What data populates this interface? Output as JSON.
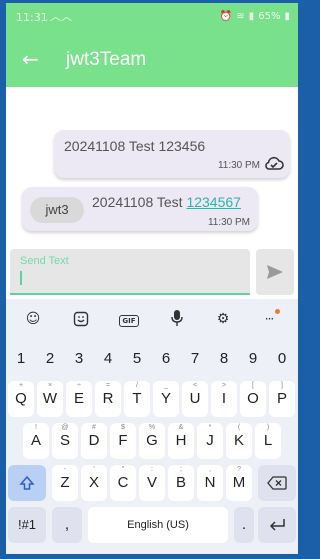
{
  "status_bar": {
    "time": "11:31",
    "wave_glyph": "^^",
    "battery": "65%",
    "icons": [
      "alarm-icon",
      "wifi-icon",
      "signal-icon",
      "battery-icon"
    ]
  },
  "app_bar": {
    "title": "jwt3Team",
    "back_glyph": "←"
  },
  "messages": {
    "outgoing": {
      "text": "20241108 Test 123456",
      "time": "11:30 PM",
      "status_icon": "cloud-check-icon"
    },
    "incoming": {
      "sender": "jwt3",
      "text_plain": "20241108 Test ",
      "text_link": "1234567",
      "time": "11:30 PM"
    }
  },
  "composer": {
    "placeholder": "Send Text",
    "send_icon": "send-icon"
  },
  "keyboard": {
    "toolbar": [
      "emoji-icon",
      "sticker-icon",
      "gif-icon",
      "mic-icon",
      "settings-icon",
      "more-icon"
    ],
    "gif_label": "GIF",
    "numbers": [
      "1",
      "2",
      "3",
      "4",
      "5",
      "6",
      "7",
      "8",
      "9",
      "0"
    ],
    "row1": [
      "Q",
      "W",
      "E",
      "R",
      "T",
      "Y",
      "U",
      "I",
      "O",
      "P"
    ],
    "row1_hints": [
      "+",
      "×",
      "÷",
      "=",
      "/",
      "_",
      "<",
      ">",
      "[",
      "]"
    ],
    "row2": [
      "A",
      "S",
      "D",
      "F",
      "G",
      "H",
      "J",
      "K",
      "L"
    ],
    "row2_hints": [
      "!",
      "@",
      "#",
      "$",
      "%",
      "&",
      "*",
      "(",
      ")"
    ],
    "row3": [
      "Z",
      "X",
      "C",
      "V",
      "B",
      "N",
      "M"
    ],
    "row3_hints": [
      "-",
      "'",
      "\"",
      ":",
      ";",
      ",",
      "?"
    ],
    "sym_label": "!#1",
    "comma": ",",
    "space_label": "English (US)",
    "period": "."
  },
  "colors": {
    "accent": "#79e08c",
    "link": "#2bb5a8",
    "bubble": "#ece8f4",
    "frame": "#1a5fa8"
  }
}
